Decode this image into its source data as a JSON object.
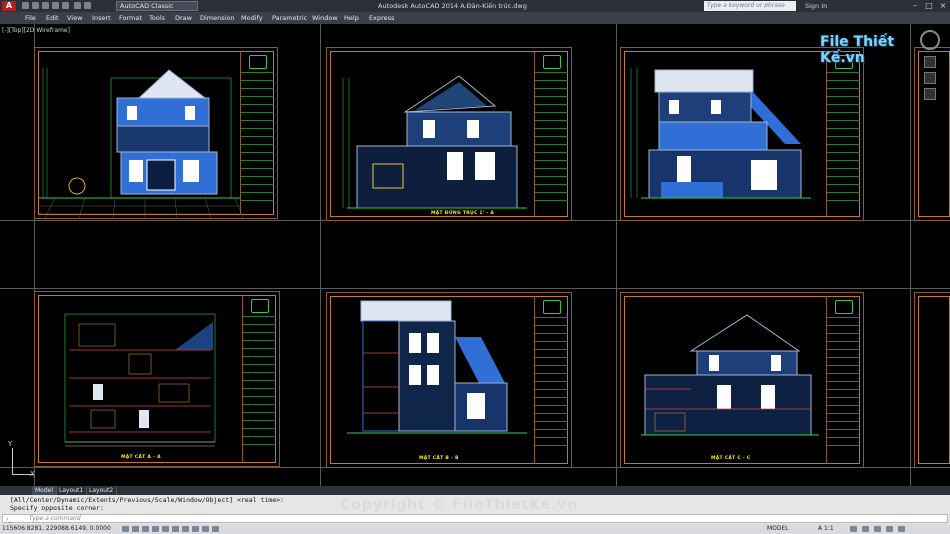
{
  "app": {
    "title": "Autodesk AutoCAD 2014    A.Đàn-Kiến trúc.dwg",
    "logo": "A",
    "workspace": "AutoCAD Classic",
    "search_placeholder": "Type a keyword or phrase",
    "sign_in": "Sign In"
  },
  "menu": [
    "File",
    "Edit",
    "View",
    "Insert",
    "Format",
    "Tools",
    "Draw",
    "Dimension",
    "Modify",
    "Parametric",
    "Window",
    "Help",
    "Express"
  ],
  "viewport": {
    "label": "[-][Top][2D Wireframe]"
  },
  "watermark": {
    "brand": "File Thiết Kế.vn"
  },
  "sheets": [
    {
      "id": "s1",
      "caption": ""
    },
    {
      "id": "s2",
      "caption": "MẶT ĐỨNG TRỤC 1' - A"
    },
    {
      "id": "s3",
      "caption": ""
    },
    {
      "id": "s4",
      "caption": "MẶT CẮT A - A"
    },
    {
      "id": "s5",
      "caption": "MẶT CẮT B - B"
    },
    {
      "id": "s6",
      "caption": "MẶT CẮT C - C"
    }
  ],
  "ucs": {
    "x": "X",
    "y": "Y"
  },
  "tabs": [
    "Model",
    "Layout1",
    "Layout2"
  ],
  "command": {
    "history_1": "[All/Center/Dynamic/Extents/Previous/Scale/Window/Object] <real time>:",
    "history_2": "Specify opposite corner:",
    "placeholder": "Type a command",
    "copyright": "Copyright © FileThietKe.vn"
  },
  "status": {
    "coords": "115606.8281, 229088.6149, 0.0000",
    "model": "MODEL",
    "scale": "A 1:1"
  },
  "colors": {
    "border_orange": "#c07a3a",
    "line_green": "#2ad14a",
    "facade_blue": "#2f6fd6",
    "roof_white": "#dfe6f2",
    "caption_yellow": "#ffea00"
  }
}
